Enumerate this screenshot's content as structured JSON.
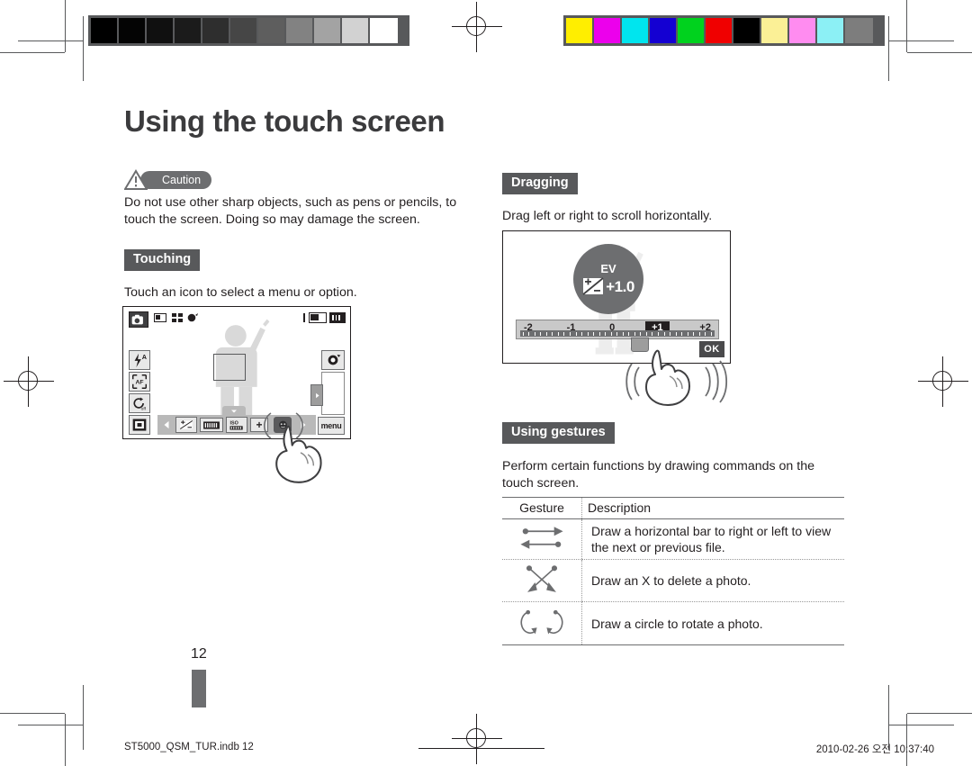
{
  "document": {
    "page_title": "Using the touch screen",
    "page_number": "12",
    "footer_left": "ST5000_QSM_TUR.indb   12",
    "footer_right": "2010-02-26   오전 10:37:40"
  },
  "caution": {
    "badge_label": "Caution",
    "text": "Do not use other sharp objects, such as pens or pencils, to touch the screen. Doing so may damage the screen."
  },
  "sections": {
    "touching": {
      "heading": "Touching",
      "text": "Touch an icon to select a menu or option."
    },
    "dragging": {
      "heading": "Dragging",
      "text": "Drag left or right to scroll horizontally."
    },
    "gestures": {
      "heading": "Using gestures",
      "text": "Perform certain functions by drawing commands on the touch screen."
    }
  },
  "gesture_table": {
    "headers": [
      "Gesture",
      "Description"
    ],
    "rows": [
      {
        "icon": "horizontal-arrows-icon",
        "description": "Draw a horizontal bar to right or left to view the next or previous file."
      },
      {
        "icon": "x-cross-icon",
        "description": "Draw an X to delete a photo."
      },
      {
        "icon": "circle-rotate-icon",
        "description": "Draw a circle to rotate a photo."
      }
    ]
  },
  "camera_screen": {
    "status_icons_left": [
      "shooting-mode-icon",
      "face-detection-icon",
      "grid-icon",
      "image-quality-icon"
    ],
    "status_icons_right": [
      "memory-card-icon",
      "battery-icon"
    ],
    "left_buttons": [
      "flash-auto-icon",
      "autofocus-icon",
      "self-timer-icon",
      "display-icon"
    ],
    "right_buttons": [
      "playback-icon",
      "zoom-tab-icon",
      "menu-button"
    ],
    "menu_label": "menu",
    "bottom_bar_icons": [
      "arrow-left-icon",
      "ev-icon",
      "white-balance-icon",
      "iso-icon",
      "plus-icon",
      "selected-option-icon",
      "arrow-right-icon"
    ]
  },
  "ev_screen": {
    "ev_label": "EV",
    "ev_value": "+1.0",
    "ev_icon": "exposure-compensation-icon",
    "scale_values": [
      "-2",
      "-1",
      "0",
      "+1",
      "+2"
    ],
    "selected_value": "+1",
    "ok_label": "OK"
  },
  "calibration": {
    "grayscale": [
      "#000000",
      "#040404",
      "#101010",
      "#1b1b1b",
      "#2e2e2e",
      "#464646",
      "#5e5e5e",
      "#828282",
      "#a3a3a3",
      "#d2d2d2",
      "#ffffff"
    ],
    "colors": [
      "#ffee00",
      "#ec00ec",
      "#00e5ee",
      "#1400d2",
      "#00d21e",
      "#f00000",
      "#000000",
      "#fbf096",
      "#ff8cf0",
      "#8cf0f5",
      "#7d7d7d"
    ]
  }
}
